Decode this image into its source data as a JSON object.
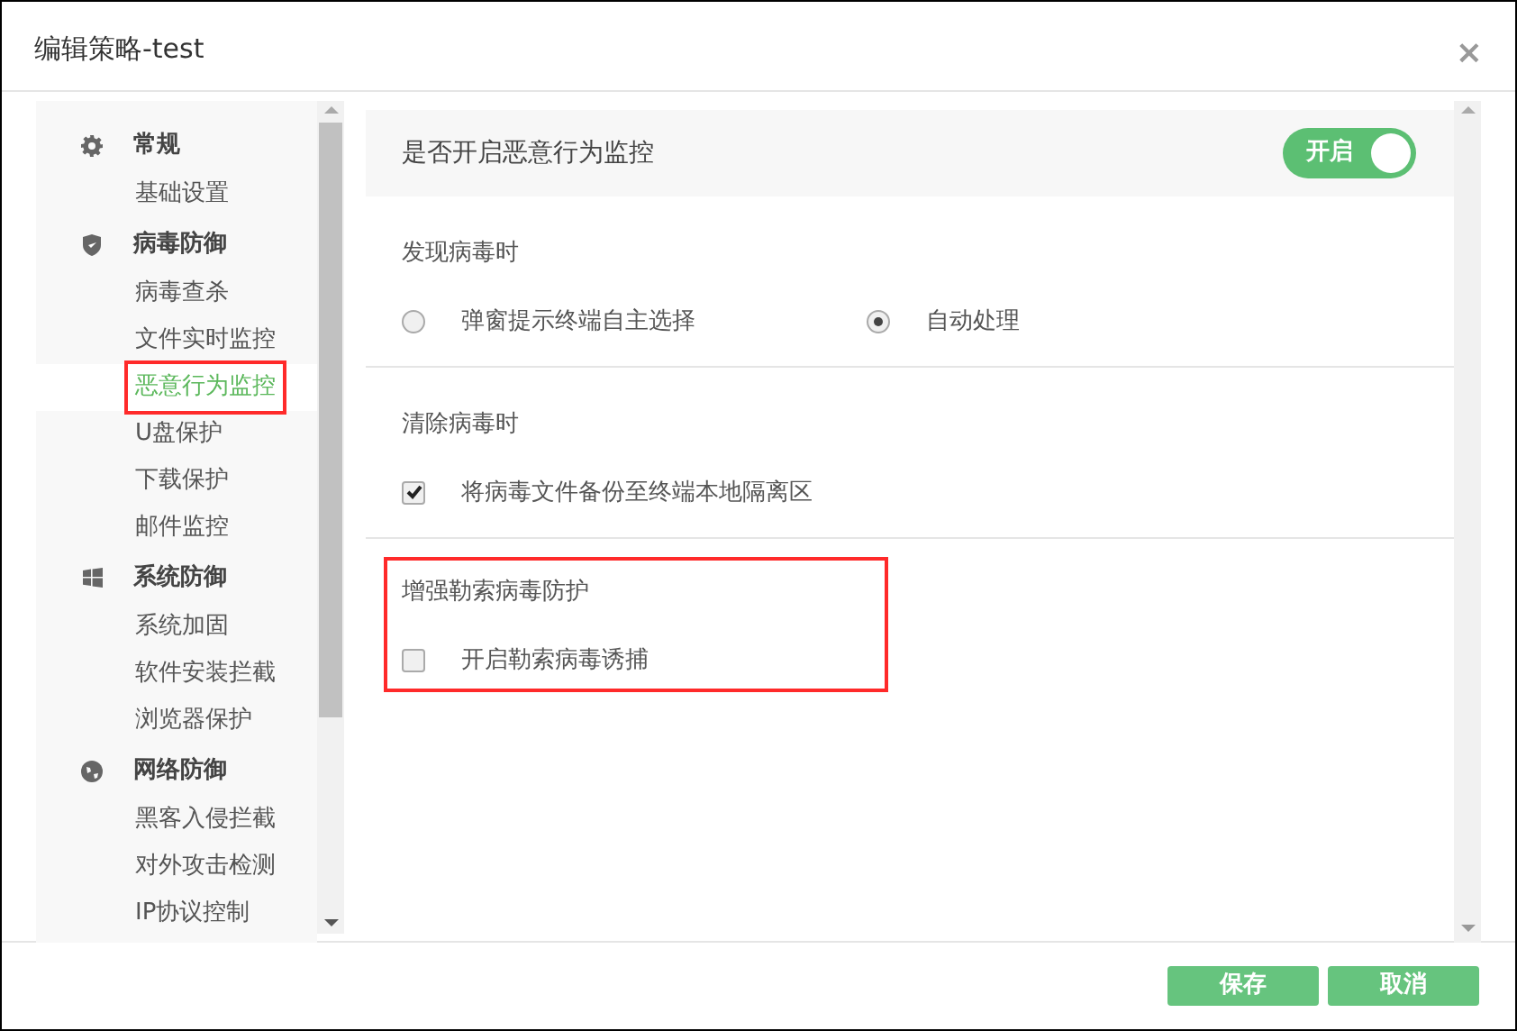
{
  "window": {
    "title": "编辑策略-test",
    "close": "×"
  },
  "sidebar": {
    "groups": [
      {
        "label": "常规",
        "items": [
          {
            "label": "基础设置",
            "selected": false,
            "highlighted": false
          }
        ]
      },
      {
        "label": "病毒防御",
        "items": [
          {
            "label": "病毒查杀",
            "selected": false,
            "highlighted": false
          },
          {
            "label": "文件实时监控",
            "selected": false,
            "highlighted": false
          },
          {
            "label": "恶意行为监控",
            "selected": true,
            "highlighted": true
          },
          {
            "label": "U盘保护",
            "selected": false,
            "highlighted": false
          },
          {
            "label": "下载保护",
            "selected": false,
            "highlighted": false
          },
          {
            "label": "邮件监控",
            "selected": false,
            "highlighted": false
          }
        ]
      },
      {
        "label": "系统防御",
        "items": [
          {
            "label": "系统加固",
            "selected": false,
            "highlighted": false
          },
          {
            "label": "软件安装拦截",
            "selected": false,
            "highlighted": false
          },
          {
            "label": "浏览器保护",
            "selected": false,
            "highlighted": false
          }
        ]
      },
      {
        "label": "网络防御",
        "items": [
          {
            "label": "黑客入侵拦截",
            "selected": false,
            "highlighted": false
          },
          {
            "label": "对外攻击检测",
            "selected": false,
            "highlighted": false
          },
          {
            "label": "IP协议控制",
            "selected": false,
            "highlighted": false
          }
        ]
      }
    ]
  },
  "header": {
    "label": "是否开启恶意行为监控",
    "toggle": {
      "on": true,
      "label": "开启"
    }
  },
  "sections": [
    {
      "title": "发现病毒时",
      "highlighted": false,
      "options": [
        {
          "kind": "radio",
          "label": "弹窗提示终端自主选择",
          "checked": false
        },
        {
          "kind": "radio",
          "label": "自动处理",
          "checked": true
        }
      ]
    },
    {
      "title": "清除病毒时",
      "highlighted": false,
      "options": [
        {
          "kind": "checkbox",
          "label": "将病毒文件备份至终端本地隔离区",
          "checked": true
        }
      ]
    },
    {
      "title": "增强勒索病毒防护",
      "highlighted": true,
      "options": [
        {
          "kind": "checkbox",
          "label": "开启勒索病毒诱捕",
          "checked": false
        }
      ]
    }
  ],
  "buttons": [
    "保存",
    "取消"
  ]
}
